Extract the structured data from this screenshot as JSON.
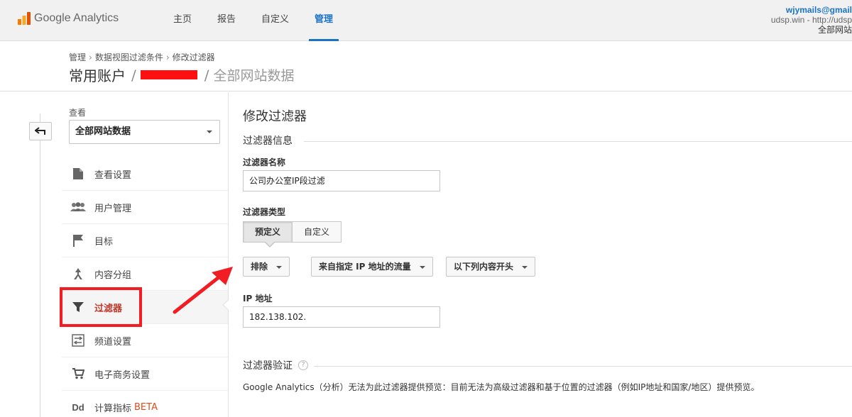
{
  "app": {
    "logo_text": "Google Analytics",
    "nav": [
      {
        "label": "主页"
      },
      {
        "label": "报告"
      },
      {
        "label": "自定义"
      },
      {
        "label": "管理",
        "active": true
      }
    ],
    "user": {
      "email": "wjymails@gmail",
      "site": "udsp.win - http://udsp",
      "view": "全部网站"
    }
  },
  "header": {
    "breadcrumb": [
      "管理",
      "数据视图过滤条件",
      "修改过滤器"
    ],
    "account": "常用账户",
    "slash": "/",
    "view_name": "全部网站数据"
  },
  "sidebar": {
    "view_label": "查看",
    "view_selected": "全部网站数据",
    "items": [
      {
        "label": "查看设置",
        "icon": "document-icon"
      },
      {
        "label": "用户管理",
        "icon": "users-icon"
      },
      {
        "label": "目标",
        "icon": "flag-icon"
      },
      {
        "label": "内容分组",
        "icon": "content-group-icon"
      },
      {
        "label": "过滤器",
        "icon": "filter-icon",
        "active": true
      },
      {
        "label": "频道设置",
        "icon": "channel-settings-icon"
      },
      {
        "label": "电子商务设置",
        "icon": "cart-icon"
      },
      {
        "label": "计算指标",
        "icon": "dd-icon",
        "badge": "BETA"
      }
    ]
  },
  "form": {
    "title": "修改过滤器",
    "section_info": "过滤器信息",
    "name_label": "过滤器名称",
    "name_value": "公司办公室IP段过滤",
    "type_label": "过滤器类型",
    "type_options": [
      "预定义",
      "自定义"
    ],
    "type_selected": "预定义",
    "dropdowns": [
      "排除",
      "来自指定 IP 地址的流量",
      "以下列内容开头"
    ],
    "ip_label": "IP 地址",
    "ip_value": "182.138.102.",
    "section_verify": "过滤器验证",
    "help_glyph": "?",
    "verify_note": "Google Analytics（分析）无法为此过滤器提供预览：目前无法为高级过滤器和基于位置的过滤器（例如IP地址和国家/地区）提供预览。"
  },
  "colors": {
    "accent": "#1a73c8",
    "annotation_red": "#f21d23",
    "active_item": "#c0392b",
    "logo_orange": "#f57c00"
  }
}
